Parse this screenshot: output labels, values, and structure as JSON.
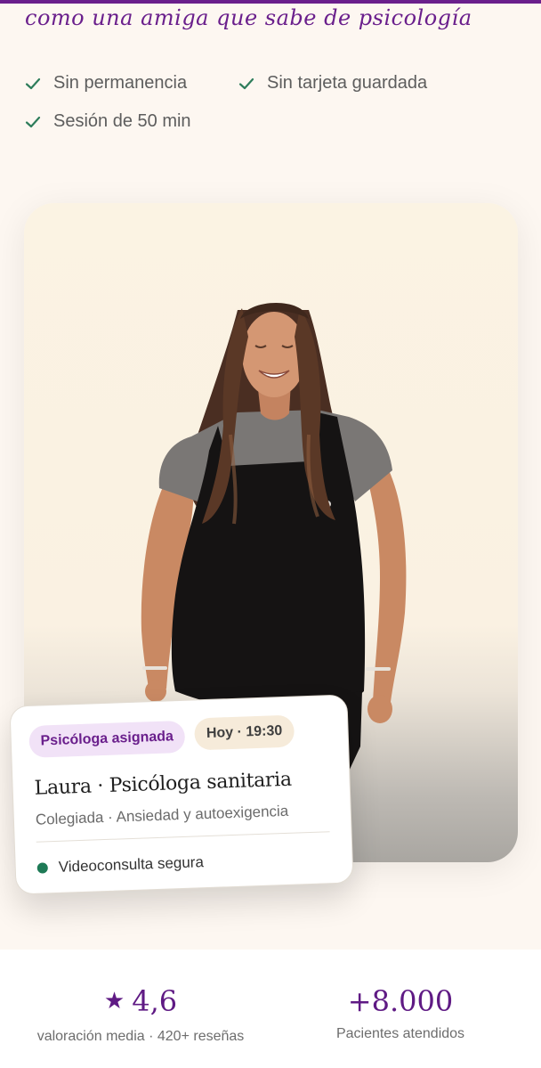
{
  "header": {
    "tagline": "como una amiga que sabe de psicología"
  },
  "benefits": [
    {
      "icon": "check-icon",
      "label": "Sin permanencia"
    },
    {
      "icon": "check-icon",
      "label": "Sin tarjeta guardada"
    },
    {
      "icon": "check-icon",
      "label": "Sesión de 50 min"
    }
  ],
  "hero": {
    "image": "smiling-woman-photo"
  },
  "therapist_card": {
    "role_badge": "Psicóloga asignada",
    "time_badge": "Hoy · 19:30",
    "name": "Laura · Psicóloga sanitaria",
    "subtitle": "Colegiada · Ansiedad y autoexigencia",
    "secure_label": "Videoconsulta segura",
    "status_color": "#1e7a56"
  },
  "stats": {
    "rating": {
      "star": "★",
      "value": "4,6",
      "label": "valoración media · 420+ reseñas"
    },
    "patients": {
      "value": "+8.000",
      "label": "Pacientes atendidos"
    }
  },
  "colors": {
    "brand": "#6a1f8c",
    "check": "#2e7d5b",
    "background": "#fdf7f1"
  }
}
